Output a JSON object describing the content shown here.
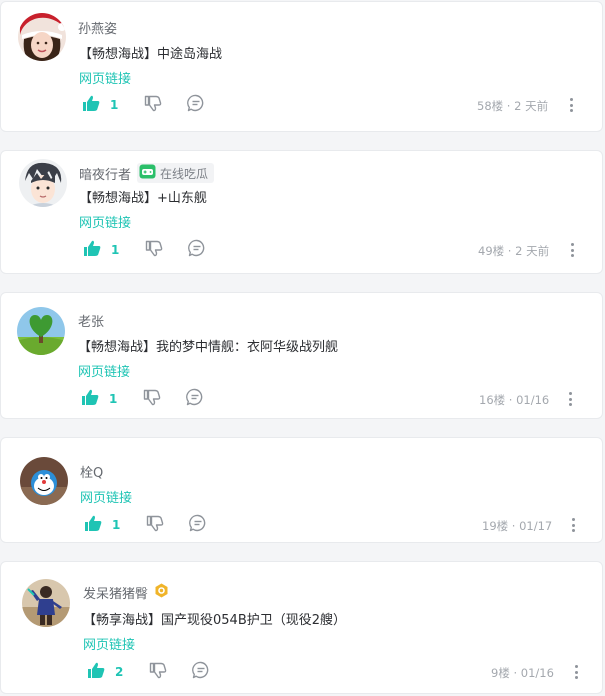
{
  "comments": [
    {
      "username": "孙燕姿",
      "content": "【畅想海战】中途岛海战",
      "link_label": "网页链接",
      "likes": "1",
      "floor": "58楼",
      "time": "2 天前",
      "separator": "·"
    },
    {
      "username": "暗夜行者",
      "badge_label": "在线吃瓜",
      "content": "【畅想海战】+山东舰",
      "link_label": "网页链接",
      "likes": "1",
      "floor": "49楼",
      "time": "2 天前",
      "separator": "·"
    },
    {
      "username": "老张",
      "content": "【畅想海战】我的梦中情舰：衣阿华级战列舰",
      "link_label": "网页链接",
      "likes": "1",
      "floor": "16楼",
      "time": "01/16",
      "separator": "·"
    },
    {
      "username": "栓Q",
      "link_label": "网页链接",
      "likes": "1",
      "floor": "19楼",
      "time": "01/17",
      "separator": "·"
    },
    {
      "username": "发呆猪猪臀",
      "content": "【畅享海战】国产现役054B护卫（现役2艘）",
      "link_label": "网页链接",
      "likes": "2",
      "floor": "9楼",
      "time": "01/16",
      "separator": "·"
    }
  ],
  "colors": {
    "accent": "#1fc4b4",
    "text": "#2b2d31",
    "muted": "#a4a8ae",
    "card_bg": "#ffffff",
    "page_bg": "#f4f5f7",
    "badge_green": "#2bbf6a",
    "badge_gold": "#f0b429"
  },
  "icons": {
    "like": "thumbs-up-icon",
    "dislike": "thumbs-down-icon",
    "reply": "comment-bubble-icon",
    "more": "more-vertical-icon",
    "gamepad": "gamepad-icon",
    "level": "level-badge-icon"
  }
}
